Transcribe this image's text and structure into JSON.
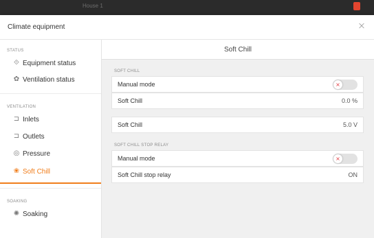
{
  "window": {
    "title": "House 1"
  },
  "dialog": {
    "title": "Climate equipment",
    "close_icon": "×"
  },
  "sidebar": {
    "sections": [
      {
        "label": "STATUS"
      },
      {
        "label": "VENTILATION"
      },
      {
        "label": "SOAKING"
      }
    ],
    "items": [
      {
        "label": "Equipment status",
        "icon": "equipment-icon",
        "glyph": "⟐"
      },
      {
        "label": "Ventilation status",
        "icon": "ventilation-icon",
        "glyph": "✿"
      },
      {
        "label": "Inlets",
        "icon": "inlet-icon",
        "glyph": "⊐"
      },
      {
        "label": "Outlets",
        "icon": "outlet-icon",
        "glyph": "⊐"
      },
      {
        "label": "Pressure",
        "icon": "pressure-icon",
        "glyph": "◎"
      },
      {
        "label": "Soft Chill",
        "icon": "soft-chill-icon",
        "glyph": "❀",
        "active": true
      },
      {
        "label": "Soaking",
        "icon": "soaking-icon",
        "glyph": "✺"
      }
    ]
  },
  "main": {
    "title": "Soft Chill",
    "groups": [
      {
        "label": "SOFT CHILL"
      },
      {
        "label": "SOFT CHILL STOP RELAY"
      }
    ],
    "rows": [
      {
        "label": "Manual mode",
        "toggle_on": false,
        "toggle_glyph": "×"
      },
      {
        "label": "Soft Chill",
        "value": "0.0 %"
      },
      {
        "label": "Soft Chill",
        "value": "5.0 V"
      },
      {
        "label": "Manual mode",
        "toggle_on": false,
        "toggle_glyph": "×"
      },
      {
        "label": "Soft Chill stop relay",
        "value": "ON"
      }
    ]
  },
  "colors": {
    "accent": "#f07d1a",
    "toggle_off_mark": "#e0393e"
  }
}
